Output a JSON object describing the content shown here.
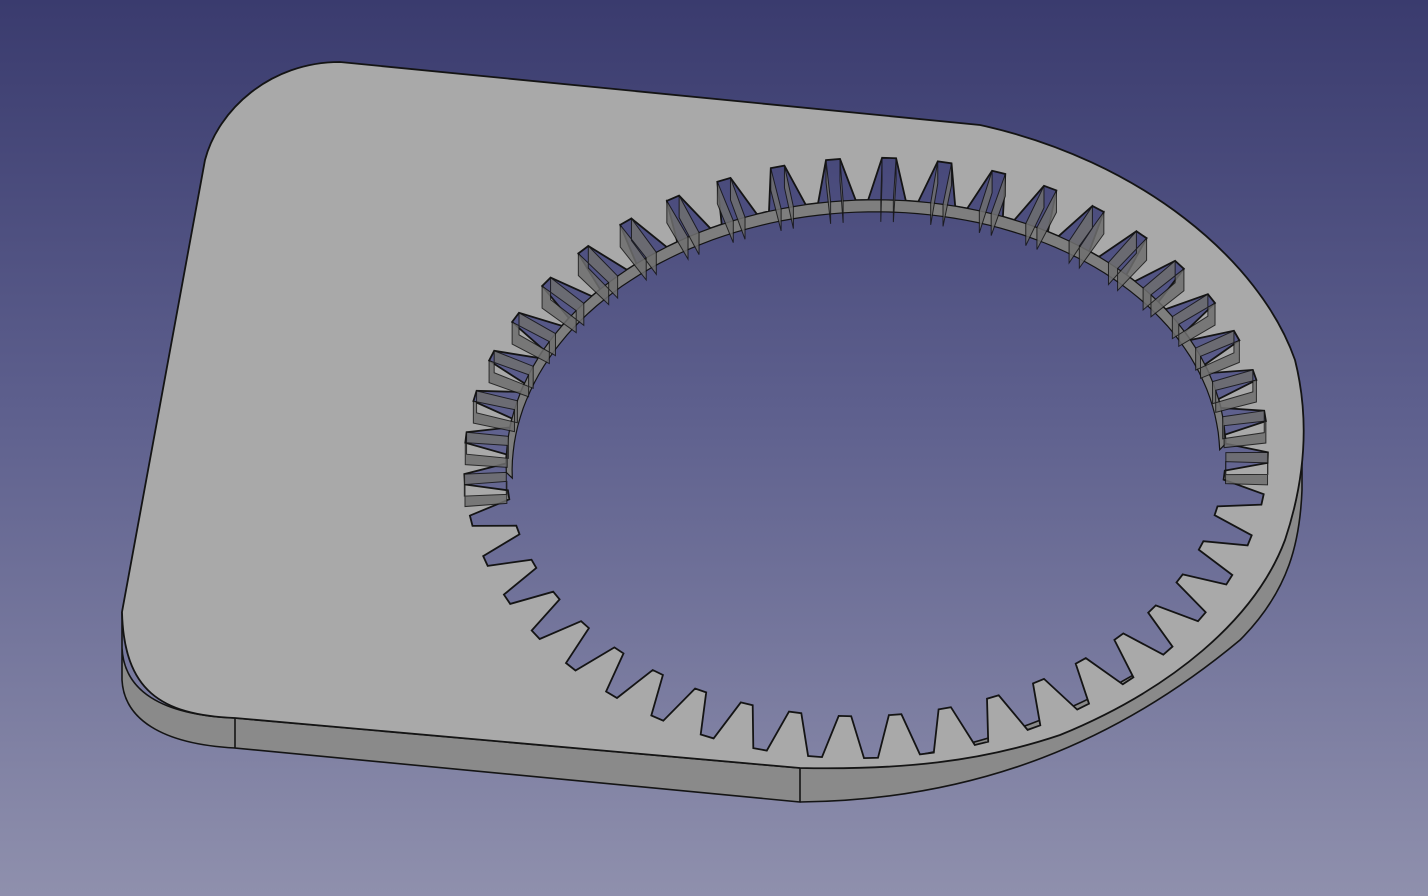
{
  "viewport": {
    "background_top": "#3a3b6e",
    "background_bottom": "#8f90ad"
  },
  "model": {
    "type": "internal-gear-plate",
    "tooth_count": 45,
    "face_color": "#a9a9a9",
    "side_color": "#8a8a8a",
    "bore_wall_color": "#7e7e7e",
    "edge_color": "#141414"
  }
}
